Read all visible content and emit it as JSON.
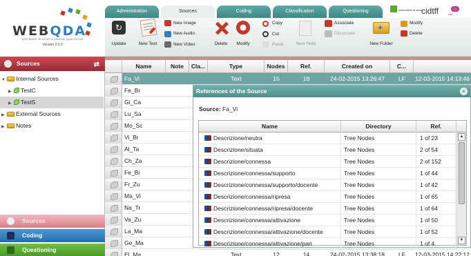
{
  "header": {
    "logo": {
      "name": "WEBQDA",
      "tagline": "SOFTWARE DE APOIO À ANÁLISE QUALITATIVA",
      "version": "Version 2.0.0"
    },
    "tabs": [
      "Administration",
      "Sources",
      "Coding",
      "Classification",
      "Questioning"
    ],
    "active_tab": "Sources",
    "ribbon": {
      "update": "Update",
      "new_text": "New Text",
      "new_image": "New Image",
      "new_audio": "New Audio",
      "new_video": "New Video",
      "delete": "Delete",
      "modify": "Modify",
      "copy": "Copy",
      "cut": "Cut",
      "paste": "Paste",
      "new_note": "New Note",
      "associate": "Associate",
      "dissociate": "Dissociate",
      "new_folder": "New Folder",
      "modify2": "Modify",
      "delete2": "Delete"
    },
    "partners": [
      "universidade de aveiro",
      "cidtff",
      "ese"
    ]
  },
  "sidebar": {
    "header": "Sources",
    "tree": [
      {
        "label": "Internal Sources",
        "level": 0,
        "expanded": true
      },
      {
        "label": "TestC",
        "level": 1,
        "expanded": false
      },
      {
        "label": "TestS",
        "level": 1,
        "expanded": false,
        "selected": true
      },
      {
        "label": "External Sources",
        "level": 0,
        "expanded": false
      },
      {
        "label": "Notes",
        "level": 0,
        "expanded": false
      }
    ],
    "nav": [
      "Sources",
      "Coding",
      "Questioning"
    ]
  },
  "table": {
    "columns": [
      "Name",
      "Note",
      "Cla...",
      "Type",
      "Nodes",
      "Ref.",
      "Created on",
      "C...",
      ""
    ],
    "selected_row": {
      "name": "Fa_Vi",
      "type": "Text",
      "nodes": "15",
      "ref": "18",
      "created": "24-02-2015 13:26:47",
      "creator": "LF",
      "modified": "12-03-2015 14:13:46"
    },
    "rows": [
      "Fa_Vi",
      "Fe_Br",
      "Gi_Ca",
      "Lu_Sa",
      "Mo_Sc",
      "Vi_Br",
      "Al_Ta",
      "Ch_Za",
      "Fe_Bi",
      "Fr_Zu",
      "Ma_Vi",
      "Na_Tr",
      "Va_Zu",
      "La_Ma",
      "Ge_Ma",
      "El_Ma"
    ],
    "last_row": {
      "type": "Text",
      "nodes": "12",
      "ref": "14",
      "created": "24-02-2015 13:38:18",
      "creator": "LF",
      "modified": "12-03-2015 14:22:12"
    }
  },
  "dialog": {
    "title": "References of the Source",
    "source_label": "Source:",
    "source_value": "Fa_Vi",
    "columns": [
      "Name",
      "Directory",
      "Ref."
    ],
    "rows": [
      {
        "name": "Descrizione/neutra",
        "directory": "Tree Nodes",
        "ref": "1 of 23"
      },
      {
        "name": "Descrizione/situata",
        "directory": "Tree Nodes",
        "ref": "2 of 54"
      },
      {
        "name": "Descrizione/connessa",
        "directory": "Tree Nodes",
        "ref": "2 of 152"
      },
      {
        "name": "Descrizione/connessa/supporto",
        "directory": "Tree Nodes",
        "ref": "1 of 44"
      },
      {
        "name": "Descrizione/connessa/supporto/docente",
        "directory": "Tree Nodes",
        "ref": "1 of 42"
      },
      {
        "name": "Descrizione/connessa/ripresa",
        "directory": "Tree Nodes",
        "ref": "1 of 65"
      },
      {
        "name": "Descrizione/connessa/ripresa/docente",
        "directory": "Tree Nodes",
        "ref": "1 of 64"
      },
      {
        "name": "Descrizione/connessa/attivazione",
        "directory": "Tree Nodes",
        "ref": "1 of 50"
      },
      {
        "name": "Descrizione/connessa/attivazione/docente",
        "directory": "Tree Nodes",
        "ref": "1 of 52"
      },
      {
        "name": "Descrizione/connessa/attivazione/pari",
        "directory": "Tree Nodes",
        "ref": "1 of 4"
      }
    ]
  },
  "colors": {
    "sources": "#b93a44",
    "coding": "#2f7fbf",
    "questioning": "#5aa832",
    "teal": "#4e8f8c"
  }
}
